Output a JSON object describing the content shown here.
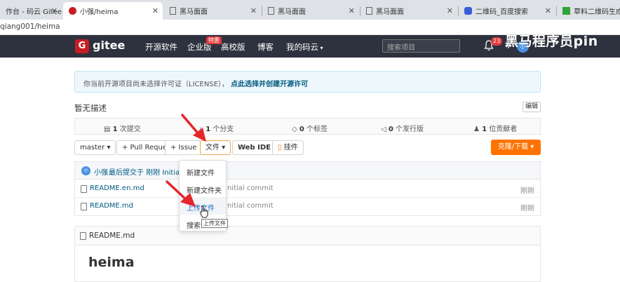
{
  "browser": {
    "tabs": [
      {
        "title": "作台 - 码云 Gitee.co",
        "active": false
      },
      {
        "title": "小强/heima",
        "active": true
      },
      {
        "title": "黑马面面",
        "active": false
      },
      {
        "title": "黑马面面",
        "active": false
      },
      {
        "title": "黑马面面",
        "active": false
      },
      {
        "title": "二维码_百度搜索",
        "active": false
      },
      {
        "title": "草料二维码生成器",
        "active": false
      }
    ],
    "address": "qiang001/heima"
  },
  "header": {
    "logo_letter": "G",
    "logo_text": "gitee",
    "nav": [
      "开源软件",
      "企业版",
      "高校版",
      "博客",
      "我的码云"
    ],
    "hot_badge": "特惠",
    "search_placeholder": "搜索项目",
    "notification_count": "23",
    "plus": "+",
    "avatar_text": "小",
    "watermark": "黑马程序员pin"
  },
  "notice": {
    "text": "你当前开源项目尚未选择许可证（LICENSE），",
    "link": "点此选择并创建开源许可"
  },
  "repo": {
    "description": "暂无描述",
    "edit_label": "编辑",
    "stats": [
      {
        "count": "1",
        "label": "次提交"
      },
      {
        "count": "1",
        "label": "个分支"
      },
      {
        "count": "0",
        "label": "个标签"
      },
      {
        "count": "0",
        "label": "个发行版"
      },
      {
        "count": "1",
        "label": "位贡献者"
      }
    ]
  },
  "toolbar": {
    "branch": "master ▾",
    "pull_request": "+ Pull Request",
    "issue": "+ Issue",
    "file": "文件 ▾",
    "web_ide": "Web IDE",
    "mount": "挂件",
    "download": "克隆/下载 ▾"
  },
  "commit": {
    "avatar": "小",
    "author": "小强",
    "text": "最后提交于 刚刚 Initial co"
  },
  "files": [
    {
      "name": "README.en.md",
      "message": "Initial commit",
      "time": "刚刚"
    },
    {
      "name": "README.md",
      "message": "Initial commit",
      "time": "刚刚"
    }
  ],
  "readme": {
    "filename": "README.md",
    "heading": "heima"
  },
  "file_menu": {
    "items": [
      "新建文件",
      "新建文件夹",
      "上传文件",
      "搜索..."
    ],
    "tooltip": "上传文件"
  },
  "colors": {
    "header_bg": "#2e323e",
    "brand_red": "#c71d23",
    "download_orange": "#fe7300",
    "link_blue": "#005980",
    "annotation_red": "#e3262b"
  }
}
